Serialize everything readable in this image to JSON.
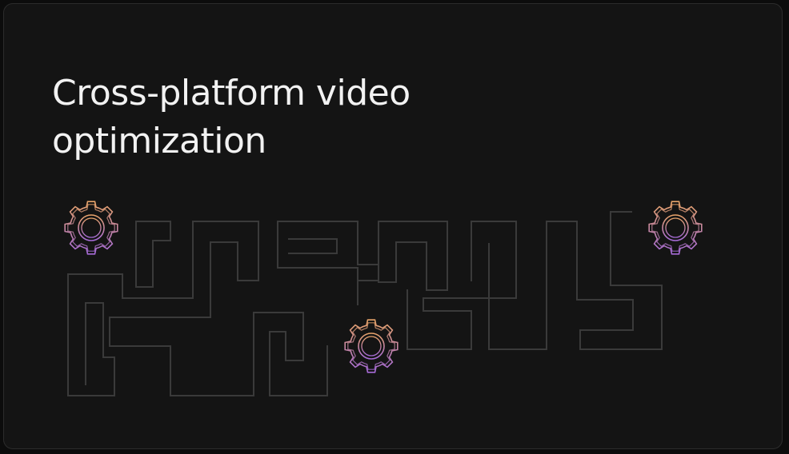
{
  "card": {
    "title": "Cross-platform video optimization"
  },
  "illustration": {
    "gear_count": 3,
    "maze_stroke": "#3c3c3c",
    "gear_gradient": [
      "#e8a46a",
      "#a66bd8"
    ],
    "icons": [
      "gear-icon",
      "gear-icon",
      "gear-icon"
    ]
  }
}
